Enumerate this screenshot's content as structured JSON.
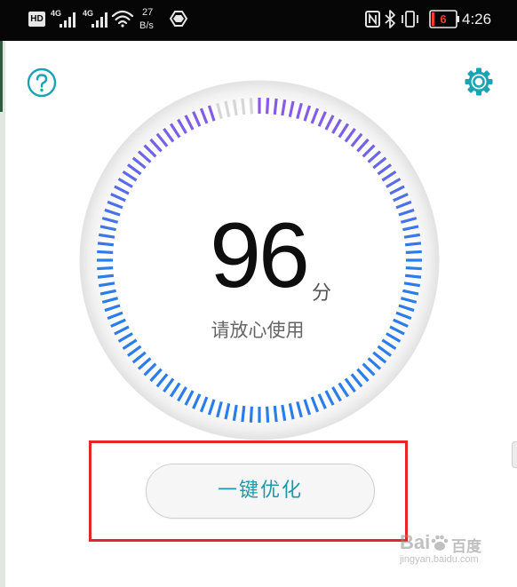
{
  "status_bar": {
    "hd_label": "HD",
    "network_1": "4G",
    "network_2": "4G",
    "speed_value": "27",
    "speed_unit": "B/s",
    "battery_level": "6",
    "time": "4:26"
  },
  "header": {
    "help_icon": "question-circle-icon",
    "settings_icon": "gear-icon"
  },
  "dial": {
    "score": "96",
    "score_unit": "分",
    "status_text": "请放心使用",
    "tick_count": 120,
    "score_fraction": 0.96,
    "accent_color_start": "#2b7de9",
    "accent_color_end": "#8a5ae6",
    "inactive_tick_color": "#d6d6d6"
  },
  "actions": {
    "optimize_label": "一键优化"
  },
  "colors": {
    "teal_accent": "#1a9aa8",
    "highlight_red": "#e3262c"
  },
  "watermark": {
    "brand": "Bai",
    "brand_tail": "百度",
    "sub": "jingyan.baidu.com"
  }
}
